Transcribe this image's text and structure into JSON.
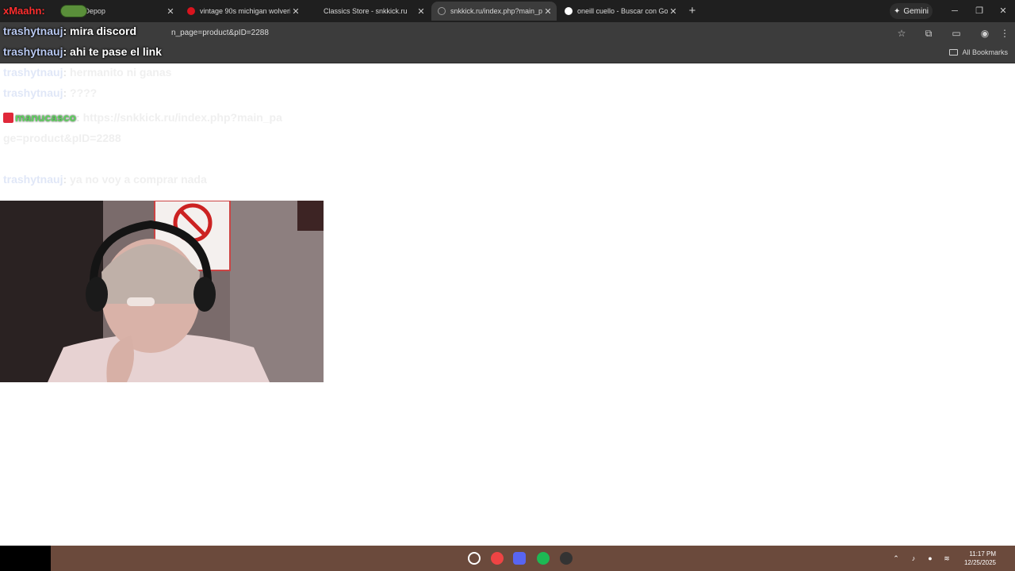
{
  "tabs": [
    {
      "title": "h | Depop",
      "color": "#d9141e"
    },
    {
      "title": "vintage 90s michigan wolverine",
      "color": "#d9141e"
    },
    {
      "title": "Classics Store - snkkick.ru",
      "color": "#9a9a9a"
    },
    {
      "title": "snkkick.ru/index.php?main_pag",
      "color": "#9a9a9a"
    },
    {
      "title": "oneill cuello - Buscar con Goog",
      "color": "#ffffff"
    }
  ],
  "gemini_label": "Gemini",
  "address": {
    "url": "n_page=product&pID=2288"
  },
  "bookmarks": {
    "all_label": "All Bookmarks"
  },
  "chat": {
    "header_name": "xMaahn:",
    "messages": [
      {
        "user": "trashytnauj",
        "text": "mira discord"
      },
      {
        "user": "trashytnauj",
        "text": "ahi te pase el link"
      },
      {
        "user": "trashytnauj",
        "text": "hermanito ni ganas"
      },
      {
        "user": "trashytnauj",
        "text": "????"
      },
      {
        "user": "manucasco",
        "text": "https://snkkick.ru/index.php?main_page=product&pID=2288"
      },
      {
        "user": "trashytnauj",
        "text": "ya no voy a comprar nada"
      }
    ]
  },
  "taskbar": {
    "time": "11:17 PM",
    "date": "12/25/2025"
  },
  "colors": {
    "tab_bar": "#1f1f1f",
    "toolbar": "#3c3c3c",
    "chat_user": "#b8c8f0",
    "mod_user": "#5cd65c"
  }
}
